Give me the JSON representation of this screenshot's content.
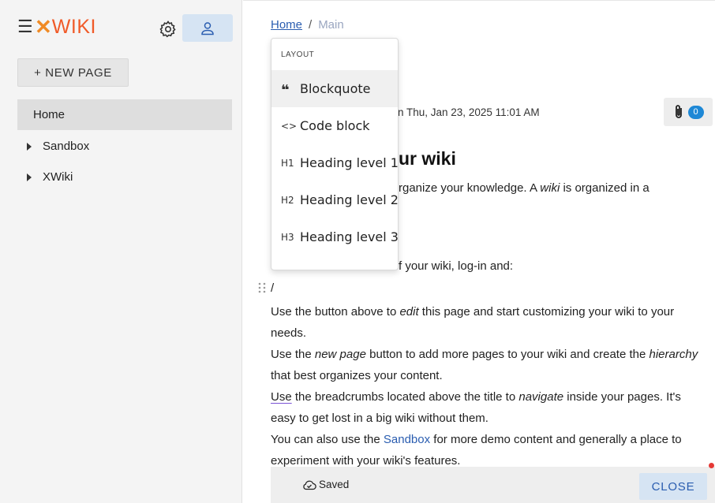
{
  "sidebar": {
    "hamburger": "☰",
    "logo_mark": "✕",
    "logo_text": "WIKI",
    "new_page_label": "+ NEW PAGE",
    "nav_home": "Home",
    "nav_items": [
      {
        "label": "Sandbox"
      },
      {
        "label": "XWiki"
      }
    ]
  },
  "breadcrumb": {
    "home": "Home",
    "separator": "/",
    "current": "Main"
  },
  "meta": {
    "date_fragment": "n Thu, Jan 23, 2025 11:01 AM",
    "attachments_count": "0"
  },
  "content": {
    "heading_fragment": "ur wiki",
    "line1_fragment": "rganize your knowledge. A ",
    "line1_em": "wiki",
    "line1_end": " is organized in a",
    "line2_fragment": "f your wiki, log-in and:",
    "slash": "/",
    "p1_a": "Use the button above to ",
    "p1_em": "edit",
    "p1_b": " this page and start customizing your wiki to your needs.",
    "p2_a": "Use the ",
    "p2_em": "new page",
    "p2_b": " button to add more pages to your wiki and create the ",
    "p2_em2": "hierarchy",
    "p2_c": " that best organizes your content.",
    "p3_use": "Use",
    "p3_a": " the breadcrumbs located above the title to ",
    "p3_em": "navigate",
    "p3_b": " inside your pages. It's easy to get lost in a big wiki without them.",
    "p4_a": "You can also use the ",
    "p4_link": "Sandbox",
    "p4_b": " for more demo content and generally a place to experiment with your wiki's features."
  },
  "dropdown": {
    "header": "LAYOUT",
    "items": [
      {
        "icon": "❝",
        "label": "Blockquote"
      },
      {
        "icon": "<>",
        "label": "Code block"
      },
      {
        "icon": "H1",
        "label": "Heading level 1"
      },
      {
        "icon": "H2",
        "label": "Heading level 2"
      },
      {
        "icon": "H3",
        "label": "Heading level 3"
      }
    ]
  },
  "bottom_bar": {
    "saved_label": "Saved",
    "close_label": "CLOSE"
  },
  "colors": {
    "accent": "#2a5db0",
    "logo": "#f05a28",
    "badge": "#1e88d6",
    "button_bg": "#d6e4f3"
  }
}
